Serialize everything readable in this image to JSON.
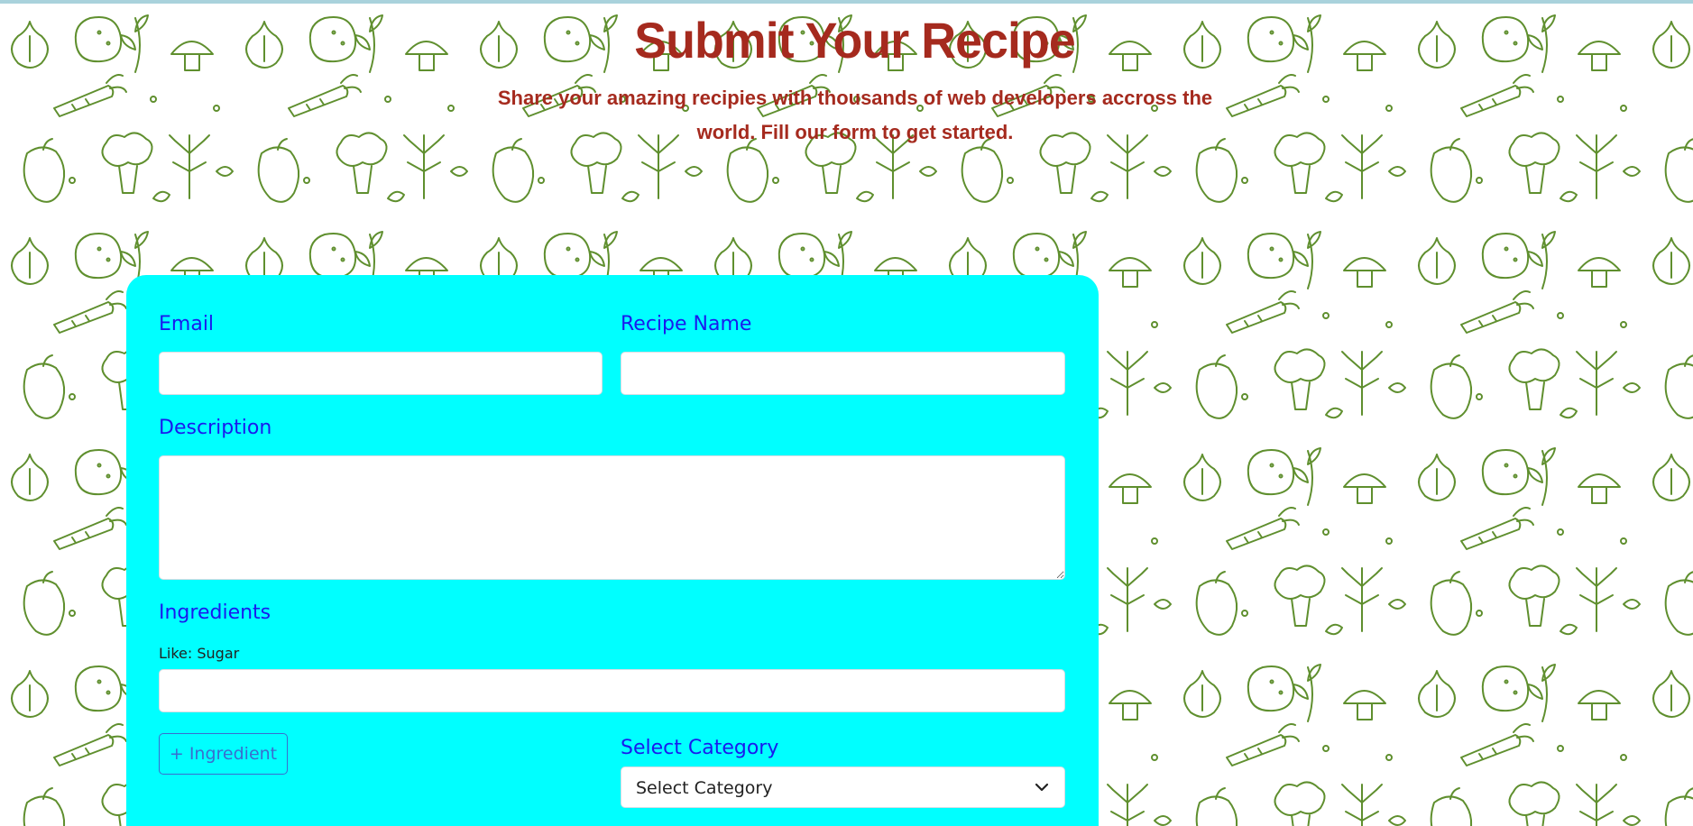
{
  "hero": {
    "title": "Submit Your Recipe",
    "subtitle": "Share your amazing recipies with thousands of web developers accross the world. Fill our form to get started."
  },
  "form": {
    "email_label": "Email",
    "recipe_name_label": "Recipe Name",
    "description_label": "Description",
    "ingredients_label": "Ingredients",
    "ingredient_hint": "Like: Sugar",
    "add_ingredient_button": "+ Ingredient",
    "category_label": "Select Category",
    "category_value": "Select Category",
    "email_value": "",
    "recipe_name_value": "",
    "description_value": "",
    "ingredient_value": ""
  },
  "colors": {
    "title": "#a52a1e",
    "card": "#00ffff",
    "label": "#1a1aee",
    "pattern": "#5f8f2e"
  },
  "icons": {
    "select": "chevron-down-icon",
    "background": "vegetable-pattern"
  }
}
